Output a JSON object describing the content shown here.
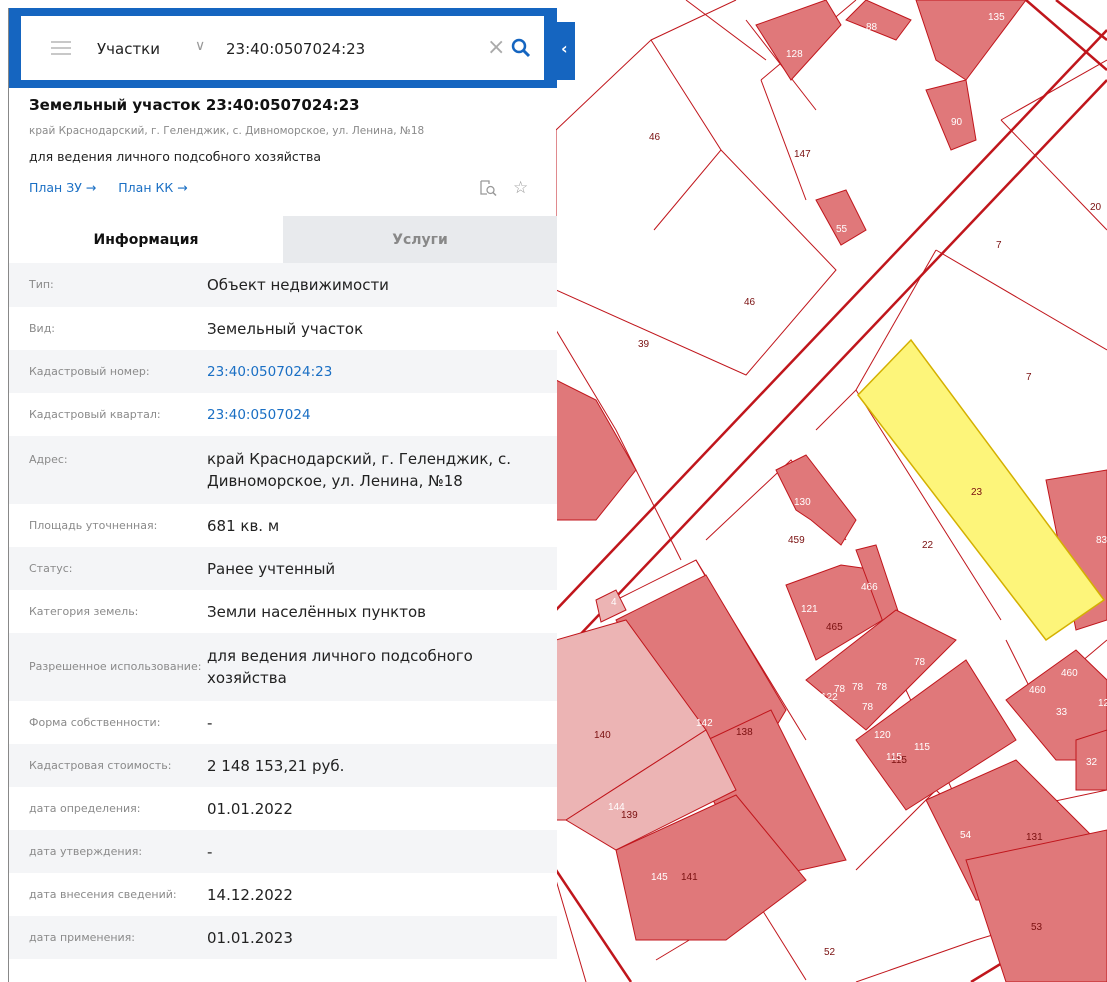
{
  "search": {
    "type": "Участки",
    "value": "23:40:0507024:23"
  },
  "object": {
    "title": "Земельный участок 23:40:0507024:23",
    "address": "край Краснодарский, г. Геленджик, с. Дивноморское, ул. Ленина, №18",
    "purpose": "для ведения личного подсобного хозяйства",
    "plan_zu": "План ЗУ →",
    "plan_kk": "План КК →"
  },
  "tabs": [
    {
      "label": "Информация"
    },
    {
      "label": "Услуги"
    }
  ],
  "info_rows": [
    {
      "label": "Тип:",
      "value": "Объект недвижимости"
    },
    {
      "label": "Вид:",
      "value": "Земельный участок"
    },
    {
      "label": "Кадастровый номер:",
      "value": "23:40:0507024:23"
    },
    {
      "label": "Кадастровый квартал:",
      "value": "23:40:0507024"
    },
    {
      "label": "Адрес:",
      "value": "край Краснодарский, г. Геленджик, с. Дивноморское, ул. Ленина, №18"
    },
    {
      "label": "Площадь уточненная:",
      "value": "681 кв. м"
    },
    {
      "label": "Статус:",
      "value": "Ранее учтенный"
    },
    {
      "label": "Категория земель:",
      "value": "Земли населённых пунктов"
    },
    {
      "label": "Разрешенное использование:",
      "value": "для ведения личного подсобного хозяйства"
    },
    {
      "label": "Форма собственности:",
      "value": "-"
    },
    {
      "label": "Кадастровая стоимость:",
      "value": "2 148 153,21 руб."
    },
    {
      "label": "дата определения:",
      "value": "01.01.2022"
    },
    {
      "label": "дата утверждения:",
      "value": "-"
    },
    {
      "label": "дата внесения сведений:",
      "value": "14.12.2022"
    },
    {
      "label": "дата применения:",
      "value": "01.01.2023"
    }
  ],
  "map_labels": [
    "128",
    "88",
    "135",
    "90",
    "46",
    "147",
    "20",
    "55",
    "7",
    "46",
    "39",
    "7",
    "130",
    "23",
    "459",
    "22",
    "83",
    "4",
    "121",
    "465",
    "466",
    "466",
    "78",
    "78",
    "78",
    "78",
    "122",
    "78",
    "460",
    "460",
    "33",
    "140",
    "142",
    "138",
    "120",
    "115",
    "115",
    "115",
    "32",
    "144",
    "139",
    "54",
    "131",
    "145",
    "141",
    "53",
    "52",
    "12"
  ],
  "colors": {
    "header_blue": "#1565c0",
    "link_blue": "#1a6fc4",
    "parcel_fill": "#e0787a",
    "parcel_border": "#c0161c",
    "selected_fill": "#fdf57a"
  }
}
